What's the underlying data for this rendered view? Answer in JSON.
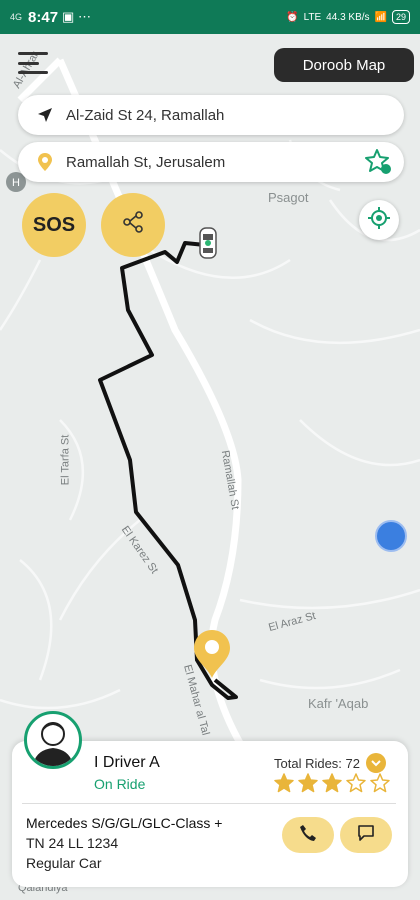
{
  "status_bar": {
    "signal": "4G",
    "time": "8:47",
    "network": "LTE",
    "data_speed": "44.3 KB/s",
    "battery": "29"
  },
  "map": {
    "map_type_label": "Doroob Map",
    "labels": {
      "ahrar": "Al-Ahrar",
      "psagot": "Psagot",
      "el_tarfa": "El Tarfa St",
      "ramallah_st": "Ramallah St",
      "el_karez": "El Karez St",
      "el_araz": "El Araz St",
      "el_mahar": "El Mahar al Tal",
      "kafr_aqab": "Kafr 'Aqab",
      "qalandiya": "Qalandiya"
    }
  },
  "pickup": {
    "value": "Al-Zaid St 24, Ramallah",
    "icon": "navigation-arrow-icon"
  },
  "dropoff": {
    "value": "Ramallah St, Jerusalem",
    "icon": "location-pin-icon"
  },
  "sos_label": "SOS",
  "driver": {
    "name": "I Driver A",
    "status": "On Ride",
    "total_rides_label": "Total Rides: 72",
    "rating": 3,
    "rating_max": 5,
    "car_model": "Mercedes S/G/GL/GLC-Class +",
    "plate": "TN 24 LL 1234",
    "car_type": "Regular Car"
  },
  "colors": {
    "status_bar": "#0f7a57",
    "accent_yellow": "#f2cd63",
    "accent_green": "#17a070",
    "route": "#111111"
  }
}
